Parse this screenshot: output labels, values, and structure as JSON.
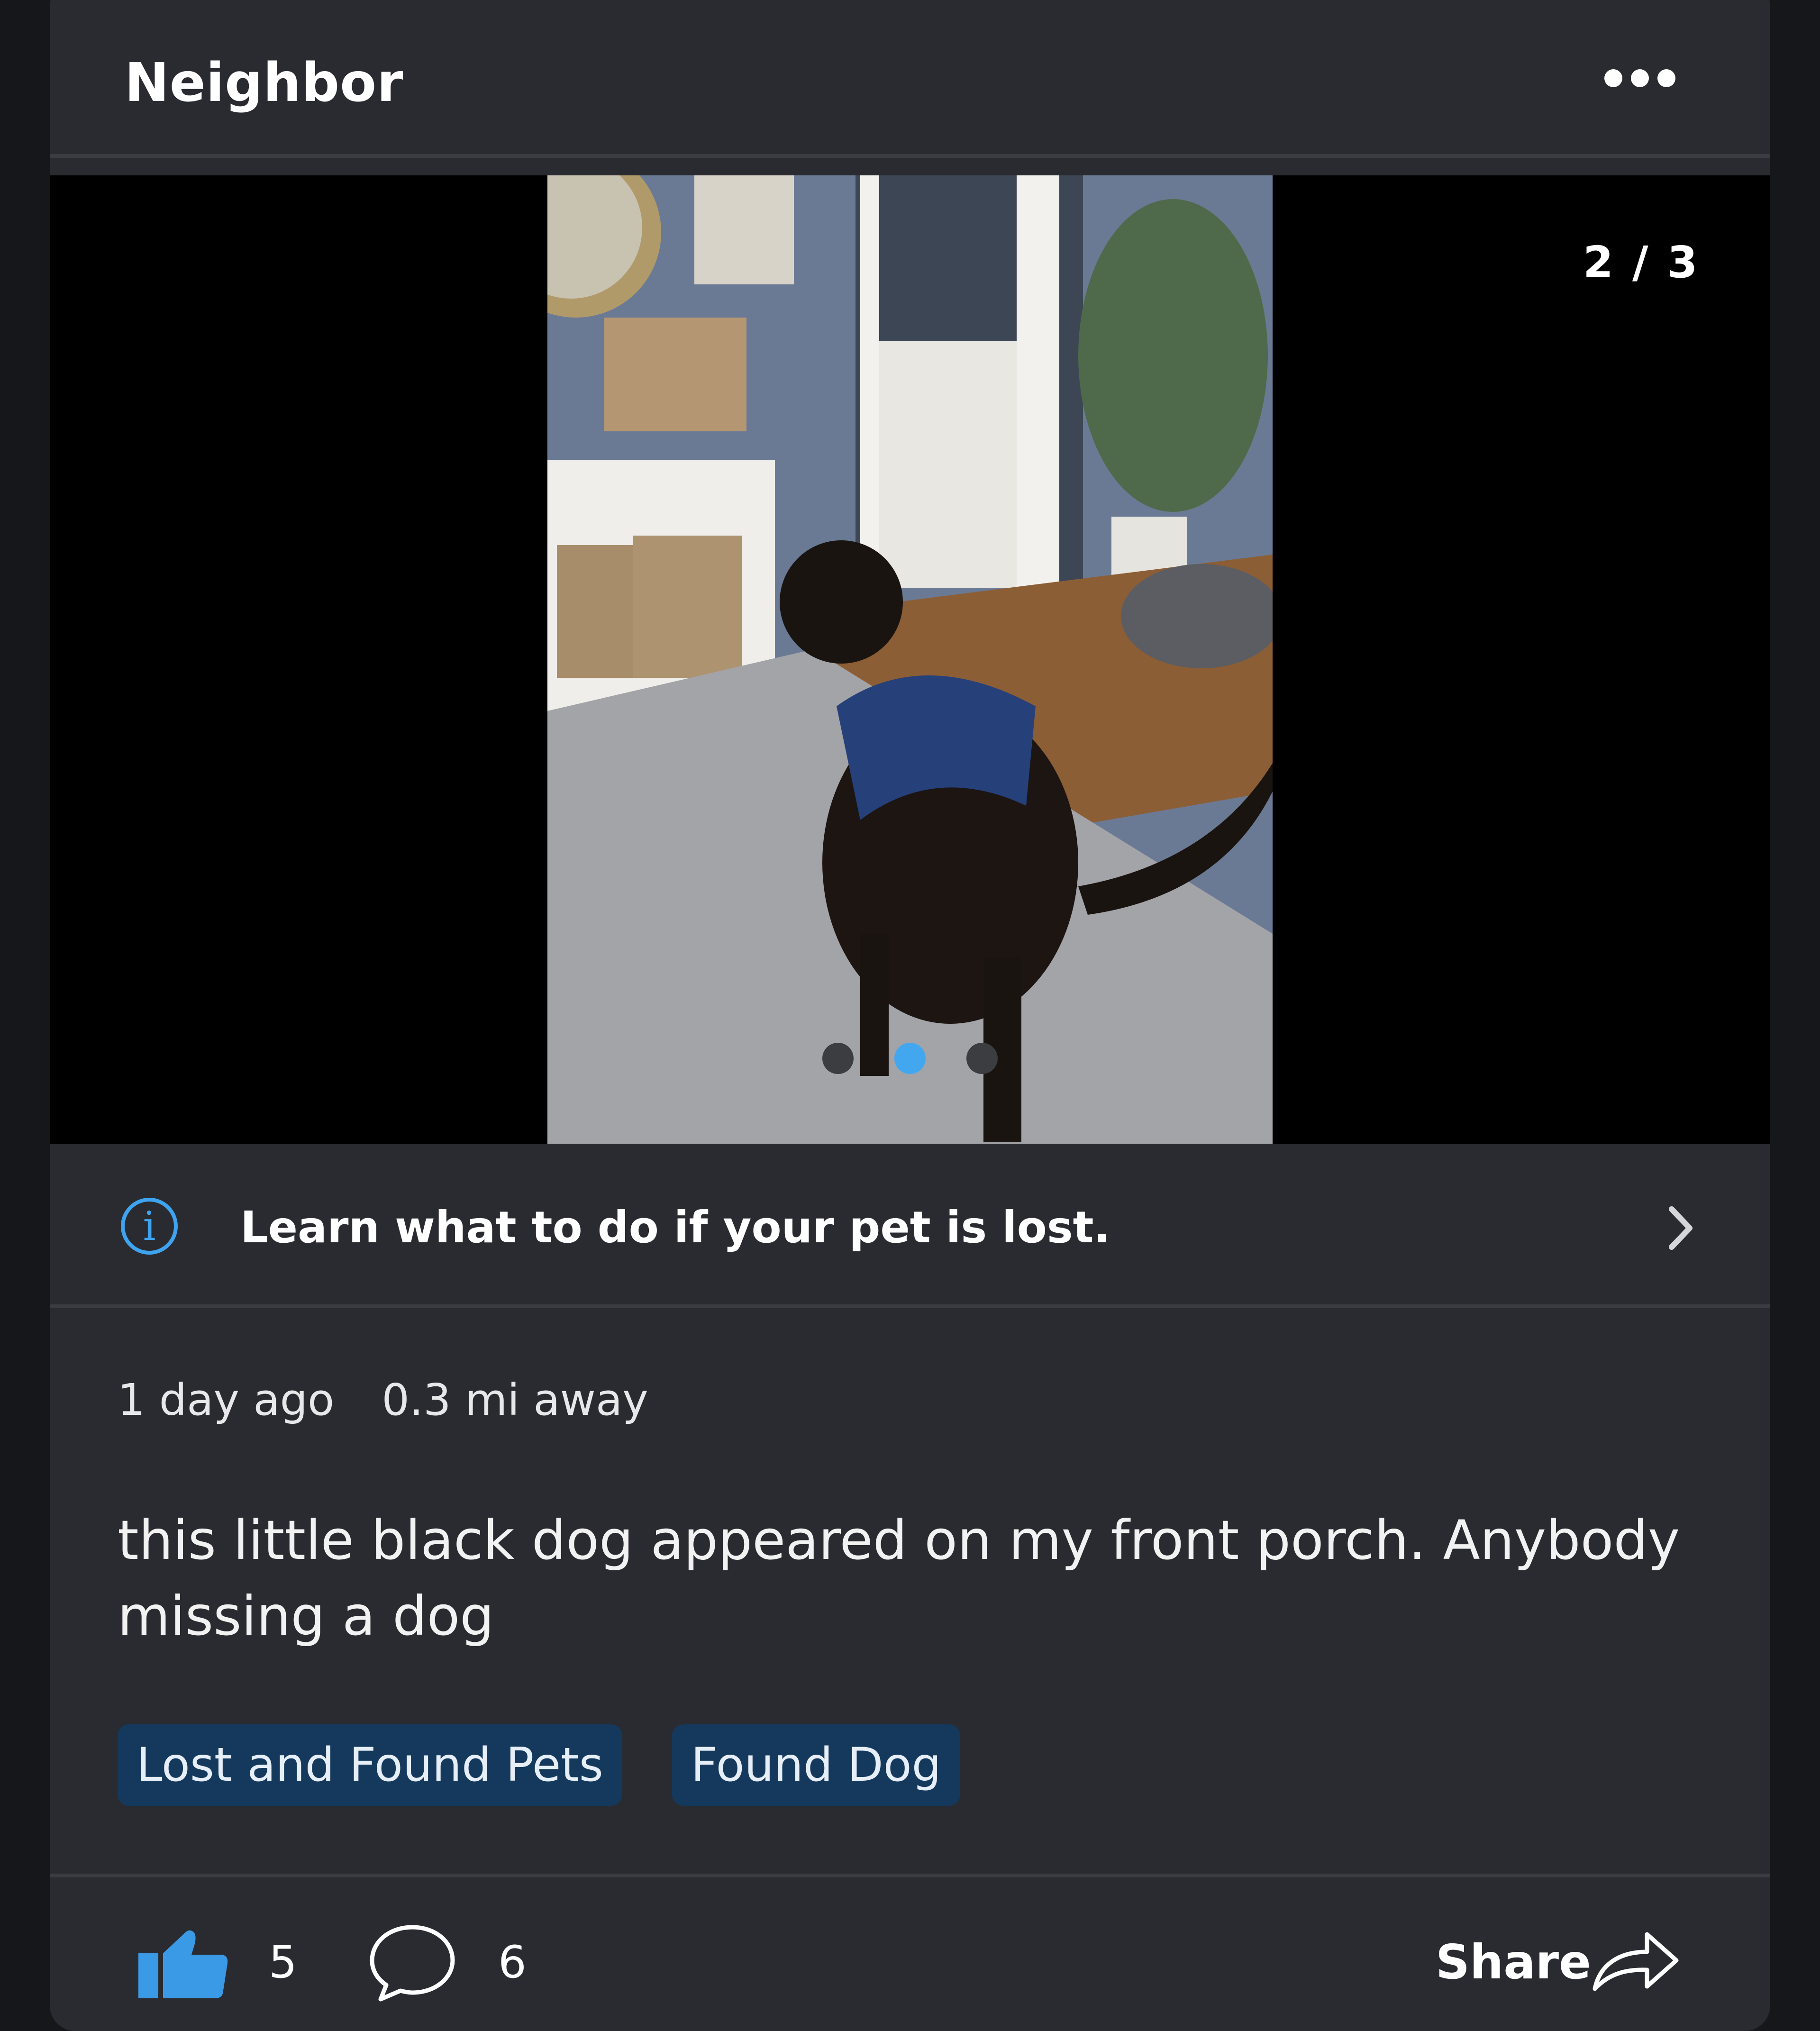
{
  "header": {
    "title": "Neighbor",
    "more_icon": "more-horizontal-icon"
  },
  "media": {
    "counter": "2 / 3",
    "total": 3,
    "current": 2
  },
  "info": {
    "icon": "info-icon",
    "text": "Learn what to do if your pet is lost.",
    "chevron_icon": "chevron-right-icon"
  },
  "meta": {
    "time": "1 day ago",
    "distance": "0.3 mi away"
  },
  "post": {
    "text": "this little black dog appeared on my front porch. Anybody missing a dog"
  },
  "tags": [
    "Lost and Found Pets",
    "Found Dog"
  ],
  "footer": {
    "like_icon": "thumbs-up-icon",
    "likes": "5",
    "comment_icon": "comment-bubble-icon",
    "comments": "6",
    "share_label": "Share",
    "share_icon": "share-arrow-icon"
  },
  "colors": {
    "card": "#2a2b30",
    "accent": "#43a7f0",
    "tag_bg": "#14395c",
    "like": "#3a9ae6"
  }
}
